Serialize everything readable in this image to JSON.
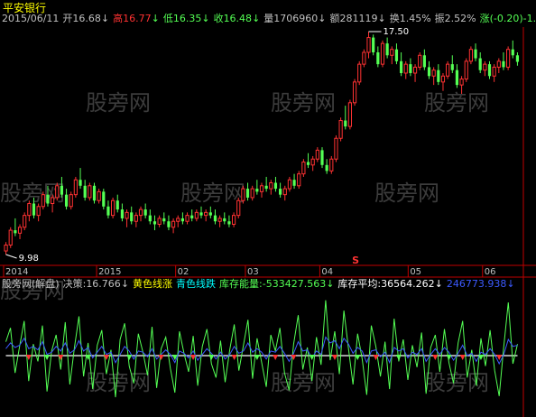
{
  "stock_name": "平安银行",
  "info_bar": {
    "date": "2015/06/11",
    "open_label": "开",
    "open_value": "16.68",
    "open_arrow": "↓",
    "high_label": "高",
    "high_value": "16.77",
    "high_arrow": "↓",
    "low_label": "低",
    "low_value": "16.35",
    "low_arrow": "↓",
    "close_label": "收",
    "close_value": "16.48",
    "close_arrow": "↓",
    "volume_label": "量",
    "volume_value": "1706960",
    "volume_arrow": "↓",
    "amount_label": "额",
    "amount_value": "281119",
    "amount_arrow": "↓",
    "turnover_label": "换",
    "turnover_value": "1.45%",
    "amplitude_label": "振",
    "amplitude_value": "2.52%",
    "change_label": "涨",
    "change_value": "(-0.20)-1.20%"
  },
  "lower_info": {
    "indicator_name": "股旁网(解盘)",
    "decision_label": "决策:",
    "decision_value": "16.766",
    "decision_arrow": "↓",
    "yellow_rise": "黄色线涨",
    "cyan_fall": "青色线跌",
    "inventory_energy_label": "库存能量",
    "inventory_energy_value": ":-533427.563",
    "inventory_energy_arrow": "↓",
    "inventory_avg_label": "库存平均:",
    "inventory_avg_value": "36564.262",
    "inventory_avg_arrow": "↓",
    "extra_value": "246773.938",
    "extra_arrow": "↓"
  },
  "colors": {
    "up": "#ff3232",
    "down": "#54ff54",
    "axis": "#c00000",
    "yellow": "#ffff00",
    "cyan": "#00ffff",
    "white": "#ffffff",
    "blue": "#3c5aff"
  },
  "watermark": "股旁网",
  "chart_data": [
    {
      "type": "candlestick",
      "max_label": "17.50",
      "min_label": "9.98",
      "signal_marker": "S",
      "x_ticks": [
        "2014",
        "2015",
        "02",
        "03",
        "04",
        "05",
        "06"
      ],
      "ohlc": [
        [
          10.1,
          10.4,
          9.98,
          10.3
        ],
        [
          10.3,
          10.9,
          10.2,
          10.8
        ],
        [
          10.8,
          11.2,
          10.6,
          10.7
        ],
        [
          10.7,
          11.0,
          10.5,
          10.9
        ],
        [
          10.9,
          11.4,
          10.8,
          11.3
        ],
        [
          11.3,
          11.8,
          11.1,
          11.7
        ],
        [
          11.7,
          11.9,
          11.2,
          11.3
        ],
        [
          11.3,
          11.7,
          11.1,
          11.6
        ],
        [
          11.6,
          12.1,
          11.5,
          12.0
        ],
        [
          12.0,
          12.3,
          11.6,
          11.7
        ],
        [
          11.7,
          12.0,
          11.4,
          11.9
        ],
        [
          11.9,
          12.4,
          11.8,
          12.3
        ],
        [
          12.3,
          12.6,
          11.9,
          12.0
        ],
        [
          12.0,
          12.2,
          11.5,
          11.6
        ],
        [
          11.6,
          12.1,
          11.5,
          12.0
        ],
        [
          12.0,
          12.6,
          11.9,
          12.5
        ],
        [
          12.5,
          12.9,
          12.2,
          12.3
        ],
        [
          12.3,
          12.5,
          11.8,
          11.9
        ],
        [
          11.9,
          12.4,
          11.8,
          12.3
        ],
        [
          12.3,
          12.4,
          11.7,
          11.8
        ],
        [
          11.8,
          12.2,
          11.7,
          12.1
        ],
        [
          12.1,
          12.2,
          11.5,
          11.6
        ],
        [
          11.6,
          11.8,
          11.2,
          11.3
        ],
        [
          11.3,
          11.9,
          11.2,
          11.8
        ],
        [
          11.8,
          12.0,
          11.4,
          11.5
        ],
        [
          11.5,
          11.7,
          11.1,
          11.2
        ],
        [
          11.2,
          11.5,
          10.9,
          11.4
        ],
        [
          11.4,
          11.6,
          11.0,
          11.1
        ],
        [
          11.1,
          11.4,
          10.9,
          11.3
        ],
        [
          11.3,
          11.6,
          11.1,
          11.5
        ],
        [
          11.5,
          11.7,
          11.2,
          11.3
        ],
        [
          11.3,
          11.5,
          11.0,
          11.1
        ],
        [
          11.1,
          11.3,
          10.8,
          11.0
        ],
        [
          11.0,
          11.3,
          10.9,
          11.2
        ],
        [
          11.2,
          11.4,
          11.0,
          11.1
        ],
        [
          11.1,
          11.3,
          10.8,
          10.9
        ],
        [
          10.9,
          11.2,
          10.7,
          11.1
        ],
        [
          11.1,
          11.3,
          10.9,
          11.2
        ],
        [
          11.2,
          11.4,
          11.0,
          11.1
        ],
        [
          11.1,
          11.4,
          11.0,
          11.3
        ],
        [
          11.3,
          11.5,
          11.1,
          11.2
        ],
        [
          11.2,
          11.5,
          11.1,
          11.4
        ],
        [
          11.4,
          11.6,
          11.2,
          11.3
        ],
        [
          11.3,
          11.5,
          11.1,
          11.4
        ],
        [
          11.4,
          11.6,
          11.2,
          11.3
        ],
        [
          11.3,
          11.5,
          11.0,
          11.1
        ],
        [
          11.1,
          11.3,
          10.9,
          11.2
        ],
        [
          11.2,
          11.4,
          11.0,
          11.1
        ],
        [
          11.1,
          11.3,
          10.9,
          11.0
        ],
        [
          11.0,
          11.4,
          10.9,
          11.3
        ],
        [
          11.3,
          11.9,
          11.2,
          11.8
        ],
        [
          11.8,
          12.3,
          11.7,
          12.2
        ],
        [
          12.2,
          12.4,
          11.8,
          11.9
        ],
        [
          11.9,
          12.3,
          11.8,
          12.2
        ],
        [
          12.2,
          12.5,
          12.0,
          12.1
        ],
        [
          12.1,
          12.4,
          11.9,
          12.3
        ],
        [
          12.3,
          12.6,
          12.1,
          12.2
        ],
        [
          12.2,
          12.5,
          12.0,
          12.4
        ],
        [
          12.4,
          12.6,
          12.1,
          12.2
        ],
        [
          12.2,
          12.4,
          11.9,
          12.0
        ],
        [
          12.0,
          12.3,
          11.8,
          12.2
        ],
        [
          12.2,
          12.6,
          12.1,
          12.5
        ],
        [
          12.5,
          12.7,
          12.2,
          12.3
        ],
        [
          12.3,
          12.8,
          12.2,
          12.7
        ],
        [
          12.7,
          13.2,
          12.6,
          13.1
        ],
        [
          13.1,
          13.4,
          12.9,
          13.0
        ],
        [
          13.0,
          13.3,
          12.8,
          13.2
        ],
        [
          13.2,
          13.6,
          13.1,
          13.5
        ],
        [
          13.5,
          13.6,
          12.9,
          13.0
        ],
        [
          13.0,
          13.2,
          12.7,
          12.8
        ],
        [
          12.8,
          13.3,
          12.7,
          13.2
        ],
        [
          13.2,
          14.0,
          13.1,
          13.9
        ],
        [
          13.9,
          14.6,
          13.8,
          14.5
        ],
        [
          14.5,
          15.0,
          14.2,
          14.3
        ],
        [
          14.3,
          15.2,
          14.2,
          15.1
        ],
        [
          15.1,
          15.9,
          15.0,
          15.8
        ],
        [
          15.8,
          16.5,
          15.7,
          16.4
        ],
        [
          16.4,
          16.9,
          16.3,
          16.8
        ],
        [
          16.8,
          17.5,
          16.6,
          17.3
        ],
        [
          17.3,
          17.4,
          16.7,
          16.8
        ],
        [
          16.8,
          17.0,
          16.3,
          16.4
        ],
        [
          16.4,
          17.2,
          16.3,
          17.1
        ],
        [
          17.1,
          17.3,
          16.6,
          16.7
        ],
        [
          16.7,
          17.0,
          16.4,
          16.9
        ],
        [
          16.9,
          17.1,
          16.4,
          16.5
        ],
        [
          16.5,
          16.8,
          16.0,
          16.1
        ],
        [
          16.1,
          16.5,
          15.9,
          16.4
        ],
        [
          16.4,
          16.6,
          16.0,
          16.1
        ],
        [
          16.1,
          16.4,
          15.8,
          16.3
        ],
        [
          16.3,
          16.8,
          16.2,
          16.7
        ],
        [
          16.7,
          16.9,
          16.2,
          16.3
        ],
        [
          16.3,
          16.5,
          15.9,
          16.0
        ],
        [
          16.0,
          16.3,
          15.7,
          16.2
        ],
        [
          16.2,
          16.4,
          15.7,
          15.8
        ],
        [
          15.8,
          16.1,
          15.5,
          16.0
        ],
        [
          16.0,
          16.5,
          15.9,
          16.4
        ],
        [
          16.4,
          16.7,
          16.1,
          16.2
        ],
        [
          16.2,
          16.4,
          15.6,
          15.7
        ],
        [
          15.7,
          16.0,
          15.4,
          15.9
        ],
        [
          15.9,
          16.6,
          15.8,
          16.5
        ],
        [
          16.5,
          17.0,
          16.4,
          16.9
        ],
        [
          16.9,
          17.1,
          16.5,
          16.6
        ],
        [
          16.6,
          16.8,
          16.1,
          16.2
        ],
        [
          16.2,
          16.5,
          16.0,
          16.4
        ],
        [
          16.4,
          16.5,
          15.9,
          16.0
        ],
        [
          16.0,
          16.4,
          15.8,
          16.3
        ],
        [
          16.3,
          16.6,
          16.1,
          16.5
        ],
        [
          16.5,
          16.8,
          16.2,
          16.3
        ],
        [
          16.3,
          17.0,
          16.2,
          16.9
        ],
        [
          16.9,
          17.2,
          16.6,
          16.7
        ],
        [
          16.7,
          16.8,
          16.35,
          16.48
        ]
      ]
    },
    {
      "type": "line",
      "title": "股旁网(解盘)",
      "ylim": [
        -5,
        5
      ],
      "series": [
        {
          "name": "黄色线涨",
          "color": "#ffffff",
          "values": [
            0,
            0,
            0,
            0,
            0,
            0,
            0,
            0,
            0,
            0,
            0,
            0,
            0,
            0,
            0,
            0,
            0,
            0,
            0,
            0,
            0,
            0,
            0,
            0,
            0,
            0,
            0,
            0,
            0,
            0,
            0,
            0,
            0,
            0,
            0,
            0,
            0,
            0,
            0,
            0,
            0,
            0,
            0,
            0,
            0,
            0,
            0,
            0,
            0,
            0,
            0,
            0,
            0,
            0,
            0,
            0,
            0,
            0,
            0,
            0,
            0,
            0,
            0,
            0,
            0,
            0,
            0,
            0,
            0,
            0,
            0,
            0,
            0,
            0,
            0,
            0,
            0,
            0,
            0,
            0,
            0,
            0,
            0,
            0,
            0,
            0,
            0,
            0,
            0,
            0,
            0,
            0,
            0,
            0,
            0,
            0,
            0,
            0,
            0,
            0,
            0,
            0,
            0,
            0,
            0,
            0,
            0,
            0,
            0,
            0,
            0,
            0,
            0
          ]
        },
        {
          "name": "库存能量",
          "color": "#54ff54",
          "values": [
            1.2,
            2.4,
            -1.5,
            0.8,
            3.0,
            -2.2,
            1.0,
            -0.5,
            2.6,
            -3.1,
            0.4,
            1.8,
            -1.2,
            2.9,
            -2.5,
            0.7,
            3.4,
            -1.8,
            1.1,
            -2.9,
            0.9,
            2.2,
            -1.6,
            0.5,
            -3.6,
            1.4,
            2.8,
            -0.9,
            -2.4,
            1.9,
            0.3,
            -1.7,
            2.5,
            -2.8,
            0.6,
            1.6,
            -1.1,
            -3.2,
            2.1,
            0.2,
            -1.4,
            1.7,
            -2.6,
            0.8,
            2.3,
            -0.7,
            -1.9,
            1.3,
            -2.3,
            0.5,
            2.7,
            -1.3,
            0.9,
            3.1,
            -2.0,
            1.5,
            -0.6,
            -2.7,
            1.8,
            0.4,
            2.4,
            -1.5,
            -3.0,
            1.0,
            3.5,
            -1.2,
            0.7,
            -2.2,
            1.6,
            -0.8,
            4.8,
            -0.4,
            2.1,
            -1.6,
            3.9,
            0.6,
            -2.5,
            1.9,
            -0.3,
            -3.4,
            2.6,
            0.8,
            -1.8,
            1.2,
            -2.9,
            3.2,
            -0.5,
            1.4,
            -2.1,
            0.9,
            -1.0,
            2.0,
            -3.3,
            0.7,
            1.8,
            -1.4,
            2.3,
            -0.6,
            -2.4,
            1.1,
            3.0,
            -1.9,
            0.5,
            -2.6,
            1.5,
            -0.9,
            2.2,
            -1.3,
            -3.5,
            0.8,
            4.6,
            -0.7,
            1.0
          ]
        },
        {
          "name": "库存平均",
          "color": "#3c5aff",
          "values": [
            0.6,
            1.1,
            0.7,
            0.9,
            1.5,
            0.6,
            0.8,
            0.5,
            1.2,
            0.1,
            0.3,
            0.8,
            0.4,
            1.1,
            0.2,
            0.5,
            1.3,
            0.4,
            0.7,
            -0.2,
            0.3,
            0.8,
            0.1,
            0.3,
            -0.6,
            0.1,
            0.8,
            0.4,
            -0.3,
            0.4,
            0.3,
            -0.1,
            0.6,
            -0.3,
            0.1,
            0.5,
            0.1,
            -0.6,
            0.4,
            0.2,
            -0.2,
            0.4,
            -0.4,
            0.1,
            0.6,
            0.2,
            -0.3,
            0.3,
            -0.3,
            0.1,
            0.8,
            0.2,
            0.4,
            1.1,
            0.3,
            0.6,
            0.3,
            -0.3,
            0.4,
            0.3,
            0.8,
            0.2,
            -0.5,
            0.2,
            1.2,
            0.4,
            0.5,
            -0.2,
            0.4,
            0.1,
            1.6,
            1.1,
            1.3,
            0.6,
            1.5,
            1.0,
            0.2,
            0.7,
            0.4,
            -0.6,
            0.4,
            0.5,
            -0.1,
            0.3,
            -0.6,
            0.7,
            0.4,
            0.6,
            -0.2,
            0.3,
            0.1,
            0.6,
            -0.5,
            0.1,
            0.6,
            0.1,
            0.7,
            0.3,
            -0.4,
            0.2,
            0.9,
            0.0,
            0.2,
            -0.5,
            0.3,
            0.1,
            0.6,
            0.1,
            -0.7,
            0.1,
            1.4,
            0.8,
            0.9
          ]
        }
      ],
      "up_marks": [
        5,
        12,
        22,
        34,
        41,
        50,
        59,
        63,
        72,
        81,
        94,
        100,
        108
      ],
      "down_marks": [
        9,
        18,
        27,
        37,
        45,
        55,
        67,
        77,
        86,
        97,
        104
      ]
    }
  ]
}
